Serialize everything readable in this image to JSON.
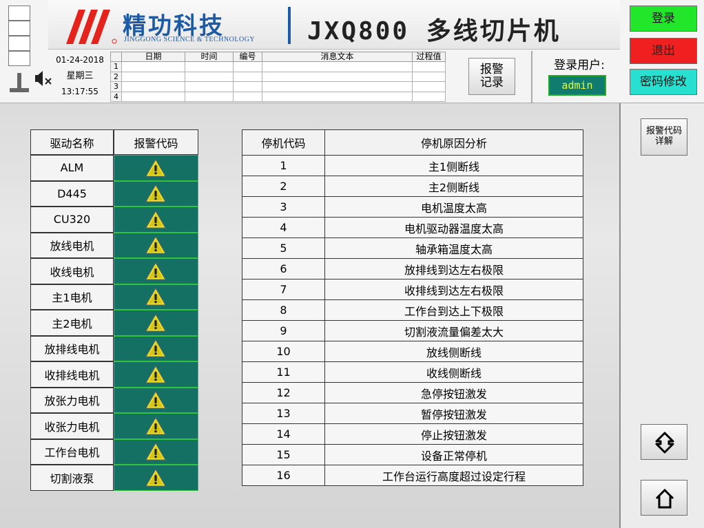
{
  "header": {
    "company_cn": "精功科技",
    "company_en": "JINGGONG SCIENCE & TECHNOLOGY",
    "machine_name": "JXQ800 多线切片机"
  },
  "status": {
    "date": "01-24-2018",
    "weekday": "星期三",
    "time": "13:17:55"
  },
  "log": {
    "columns": [
      "日期",
      "时间",
      "编号",
      "消息文本",
      "过程值"
    ],
    "row_numbers": [
      "1",
      "2",
      "3",
      "4"
    ]
  },
  "buttons": {
    "alarm_record": "报警记录",
    "login": "登录",
    "exit": "退出",
    "password_change": "密码修改",
    "alarm_code_detail": "报警代码详解"
  },
  "user": {
    "label": "登录用户:",
    "name": "admin"
  },
  "drive_table": {
    "headers": [
      "驱动名称",
      "报警代码"
    ],
    "rows": [
      "ALM",
      "D445",
      "CU320",
      "放线电机",
      "收线电机",
      "主1电机",
      "主2电机",
      "放排线电机",
      "收排线电机",
      "放张力电机",
      "收张力电机",
      "工作台电机",
      "切割液泵"
    ]
  },
  "stop_table": {
    "headers": [
      "停机代码",
      "停机原因分析"
    ],
    "rows": [
      [
        "1",
        "主1侧断线"
      ],
      [
        "2",
        "主2侧断线"
      ],
      [
        "3",
        "电机温度太高"
      ],
      [
        "4",
        "电机驱动器温度太高"
      ],
      [
        "5",
        "轴承箱温度太高"
      ],
      [
        "6",
        "放排线到达左右极限"
      ],
      [
        "7",
        "收排线到达左右极限"
      ],
      [
        "8",
        "工作台到达上下极限"
      ],
      [
        "9",
        "切割液流量偏差太大"
      ],
      [
        "10",
        "放线侧断线"
      ],
      [
        "11",
        "收线侧断线"
      ],
      [
        "12",
        "急停按钮激发"
      ],
      [
        "13",
        "暂停按钮激发"
      ],
      [
        "14",
        "停止按钮激发"
      ],
      [
        "15",
        "设备正常停机"
      ],
      [
        "16",
        "工作台运行高度超过设定行程"
      ]
    ]
  },
  "colors": {
    "brand_blue": "#1c5aa6",
    "brand_red": "#e4241c",
    "alarm_cell": "#147062",
    "user_box_bg": "#107c70",
    "user_box_text": "#e6ff3c",
    "login_btn": "#22e62a",
    "exit_btn": "#f02020",
    "pwd_btn": "#27e0cf"
  },
  "icons": {
    "alarm_status": "warning-triangle-icon",
    "nav": "move-arrows-icon",
    "home": "home-icon",
    "mute": "speaker-muted-icon",
    "light_tower": "signal-tower-icon"
  }
}
